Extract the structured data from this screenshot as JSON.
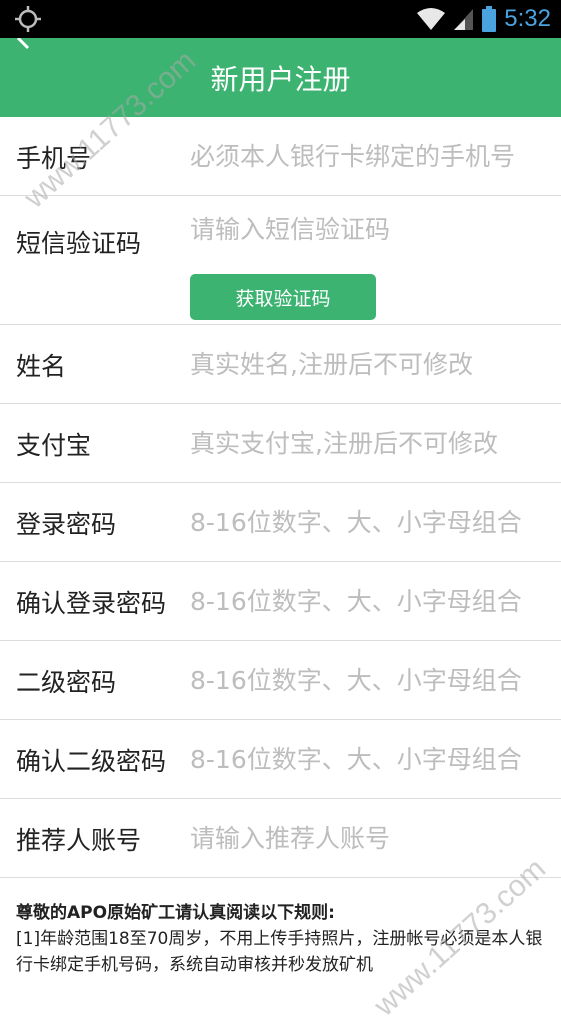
{
  "status_bar": {
    "time": "5:32",
    "left_icon": "gps-icon",
    "icons": [
      "wifi-icon",
      "signal-icon",
      "battery-icon"
    ],
    "accent": "#4aa3df"
  },
  "app_bar": {
    "title": "新用户注册",
    "back_icon": "back-arrow-icon",
    "color": "#3cb371"
  },
  "form": {
    "phone": {
      "label": "手机号",
      "placeholder": "必须本人银行卡绑定的手机号"
    },
    "sms_code": {
      "label": "短信验证码",
      "placeholder": "请输入短信验证码",
      "button": "获取验证码"
    },
    "name": {
      "label": "姓名",
      "placeholder": "真实姓名,注册后不可修改"
    },
    "alipay": {
      "label": "支付宝",
      "placeholder": "真实支付宝,注册后不可修改"
    },
    "login_password": {
      "label": "登录密码",
      "placeholder": "8-16位数字、大、小字母组合"
    },
    "confirm_login_password": {
      "label": "确认登录密码",
      "placeholder": "8-16位数字、大、小字母组合"
    },
    "secondary_password": {
      "label": "二级密码",
      "placeholder": "8-16位数字、大、小字母组合"
    },
    "confirm_secondary_password": {
      "label": "确认二级密码",
      "placeholder": "8-16位数字、大、小字母组合"
    },
    "referrer": {
      "label": "推荐人账号",
      "placeholder": "请输入推荐人账号"
    }
  },
  "rules": {
    "title": "尊敬的APO原始矿工请认真阅读以下规则:",
    "item1": "[1]年龄范围18至70周岁，不用上传手持照片，注册帐号必须是本人银行卡绑定手机号码，系统自动审核并秒发放矿机"
  },
  "watermark": {
    "top": "www.11773.com",
    "bottom": "www.11773.com"
  }
}
